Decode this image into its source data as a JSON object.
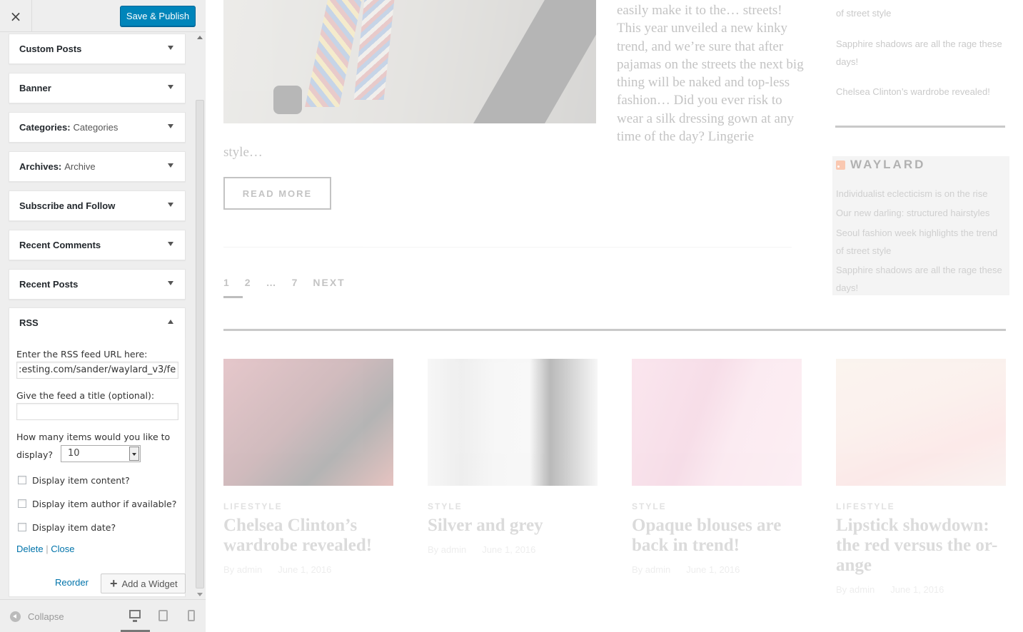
{
  "header": {
    "close_icon": "×",
    "save_label": "Save & Publish"
  },
  "widgets": [
    {
      "label": "Custom Posts",
      "subtitle": ""
    },
    {
      "label": "Banner",
      "subtitle": ""
    },
    {
      "label": "Categories:",
      "subtitle": "Categories"
    },
    {
      "label": "Archives:",
      "subtitle": "Archive"
    },
    {
      "label": "Subscribe and Follow",
      "subtitle": ""
    },
    {
      "label": "Recent Comments",
      "subtitle": ""
    },
    {
      "label": "Recent Posts",
      "subtitle": ""
    },
    {
      "label": "RSS",
      "subtitle": "",
      "expanded": true
    }
  ],
  "rss_form": {
    "url_label": "Enter the RSS feed URL here:",
    "url_value": ":esting.com/sander/waylard_v3/fe",
    "title_label": "Give the feed a title (optional):",
    "title_value": "",
    "items_label_1": "How many items would you like to",
    "items_label_2": "display?",
    "items_value": "10",
    "cb_content": "Display item content?",
    "cb_author": "Display item author if available?",
    "cb_date": "Display item date?",
    "delete": "Delete",
    "separator": "|",
    "close": "Close"
  },
  "footer_actions": {
    "reorder": "Reorder",
    "add_widget": "Add a Widget",
    "add_icon": "+"
  },
  "sidebar_footer": {
    "collapse": "Collapse"
  },
  "preview": {
    "excerpt": "easily make it to the… streets! This year unveiled a new kinky trend, and we’re sure that after pajamas on the streets the next big thing will be naked and top-less fashion… Did you ever risk to wear a silk dressing gown at any time of the day? Lingerie",
    "excerpt_tail": "style…",
    "read_more": "READ MORE",
    "pagination": [
      "1",
      "2",
      "…",
      "7",
      "NEXT"
    ],
    "right_top": [
      "of street style",
      "Sapphire shadows are all the rage these days!",
      "Chelsea Clinton’s wardrobe revealed!"
    ],
    "rss_widget": {
      "title": "WAYLARD",
      "items": [
        "Individualist eclecticism is on the rise",
        "Our new darling: structured hairstyles",
        "Seoul fashion week highlights the trend of street style",
        "Sapphire shadows are all the rage these days!"
      ]
    },
    "posts": [
      {
        "category": "LIFESTYLE",
        "title": "Chelsea Clinton’s wardrobe revealed!",
        "author": "By admin",
        "date": "June 1, 2016",
        "color": "#b65f6a"
      },
      {
        "category": "STYLE",
        "title": "Silver and grey",
        "author": "By admin",
        "date": "June 1, 2016",
        "color": "#d6d6d6"
      },
      {
        "category": "STYLE",
        "title": "Opaque blouses are back in trend!",
        "author": "By admin",
        "date": "June 1, 2016",
        "color": "#f2b8cf"
      },
      {
        "category": "LIFESTYLE",
        "title": "Lipstick showdown: the red versus the or-ange",
        "author": "By admin",
        "date": "June 1, 2016",
        "color": "#f3d6cc"
      }
    ]
  }
}
